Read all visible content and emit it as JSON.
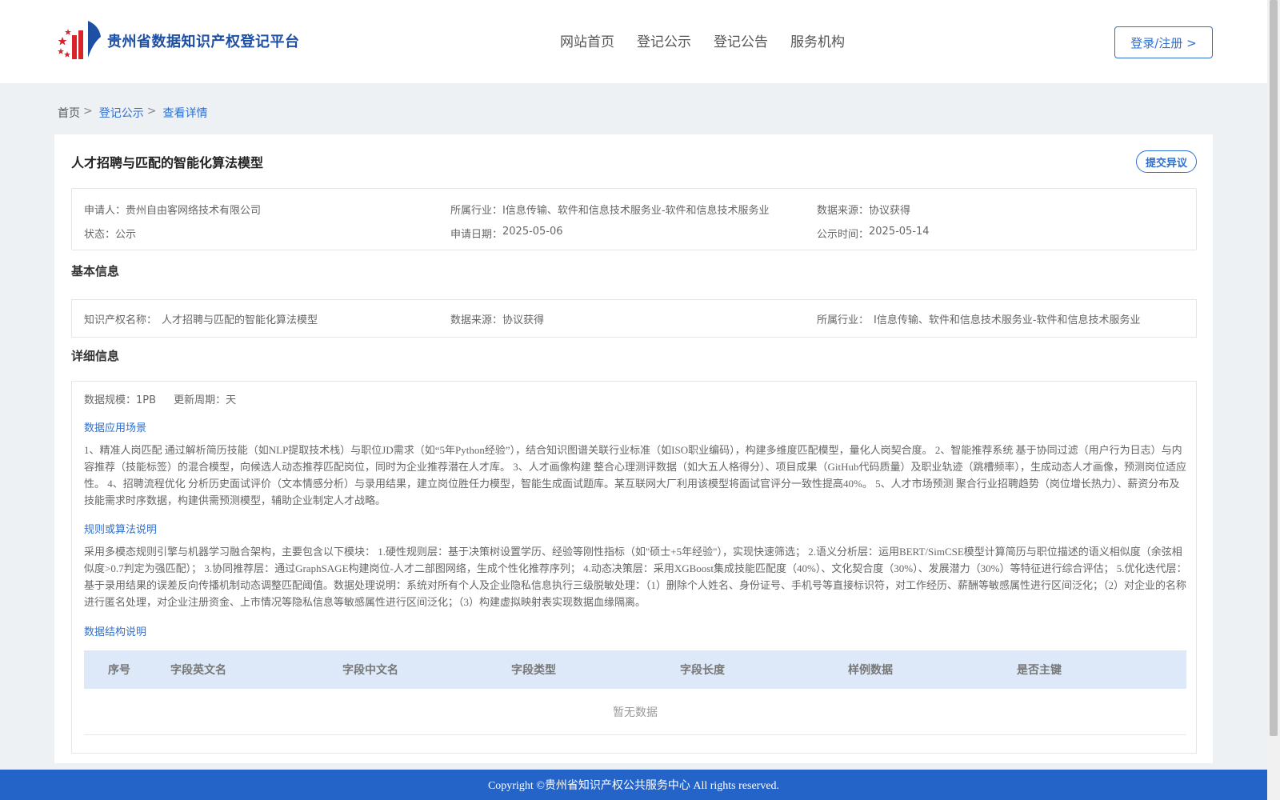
{
  "header": {
    "logo_text": "贵州省数据知识产权登记平台",
    "nav": [
      "网站首页",
      "登记公示",
      "登记公告",
      "服务机构"
    ],
    "login_label": "登录/注册 >"
  },
  "breadcrumb": {
    "home": "首页",
    "list": "登记公示",
    "current": "查看详情",
    "sep": ">"
  },
  "detail": {
    "title": "人才招聘与匹配的智能化算法模型",
    "objection_label": "提交异议",
    "summary": {
      "applicant_label": "申请人：",
      "applicant": "贵州自由客网络技术有限公司",
      "industry_label": "所属行业：",
      "industry": "I信息传输、软件和信息技术服务业-软件和信息技术服务业",
      "source_label": "数据来源：",
      "source": "协议获得",
      "status_label": "状态：",
      "status": "公示",
      "apply_date_label": "申请日期：",
      "apply_date": "2025-05-06",
      "publish_time_label": "公示时间：",
      "publish_time": "2025-05-14"
    },
    "basic_title": "基本信息",
    "basic": {
      "ip_name_label": "知识产权名称：",
      "ip_name": "人才招聘与匹配的智能化算法模型",
      "source_label": "数据来源：",
      "source": "协议获得",
      "industry_label": "所属行业：",
      "industry": "I信息传输、软件和信息技术服务业-软件和信息技术服务业"
    },
    "detail_title": "详细信息",
    "scale": "数据规模：1PB",
    "cycle": "更新周期：天",
    "scenario_title": "数据应用场景",
    "scenario_text": "1、精准人岗匹配 通过解析简历技能（如NLP提取技术栈）与职位JD需求（如“5年Python经验”），结合知识图谱关联行业标准（如ISO职业编码），构建多维度匹配模型，量化人岗契合度。 2、智能推荐系统 基于协同过滤（用户行为日志）与内容推荐（技能标签）的混合模型，向候选人动态推荐匹配岗位，同时为企业推荐潜在人才库。 3、人才画像构建 整合心理测评数据（如大五人格得分）、项目成果（GitHub代码质量）及职业轨迹（跳槽频率），生成动态人才画像，预测岗位适应性。 4、招聘流程优化 分析历史面试评价（文本情感分析）与录用结果，建立岗位胜任力模型，智能生成面试题库。某互联网大厂利用该模型将面试官评分一致性提高40%。 5、人才市场预测 聚合行业招聘趋势（岗位增长热力）、薪资分布及技能需求时序数据，构建供需预测模型，辅助企业制定人才战略。",
    "algo_title": "规则或算法说明",
    "algo_text": "采用多模态规则引擎与机器学习融合架构，主要包含以下模块： 1.硬性规则层：基于决策树设置学历、经验等刚性指标（如\"硕士+5年经验\"），实现快速筛选； 2.语义分析层：运用BERT/SimCSE模型计算简历与职位描述的语义相似度（余弦相似度>0.7判定为强匹配）； 3.协同推荐层：通过GraphSAGE构建岗位-人才二部图网络，生成个性化推荐序列； 4.动态决策层：采用XGBoost集成技能匹配度（40%）、文化契合度（30%）、发展潜力（30%）等特征进行综合评估； 5.优化迭代层：基于录用结果的误差反向传播机制动态调整匹配阈值。数据处理说明：系统对所有个人及企业隐私信息执行三级脱敏处理：（1）删除个人姓名、身份证号、手机号等直接标识符，对工作经历、薪酬等敏感属性进行区间泛化；（2）对企业的名称进行匿名处理，对企业注册资金、上市情况等隐私信息等敏感属性进行区间泛化；（3）构建虚拟映射表实现数据血缘隔离。",
    "struct_title": "数据结构说明",
    "table_headers": [
      "序号",
      "字段英文名",
      "字段中文名",
      "字段类型",
      "字段长度",
      "样例数据",
      "是否主键"
    ],
    "empty_text": "暂无数据"
  },
  "footer": {
    "copyright": "Copyright ©贵州省知识产权公共服务中心 All rights reserved."
  }
}
